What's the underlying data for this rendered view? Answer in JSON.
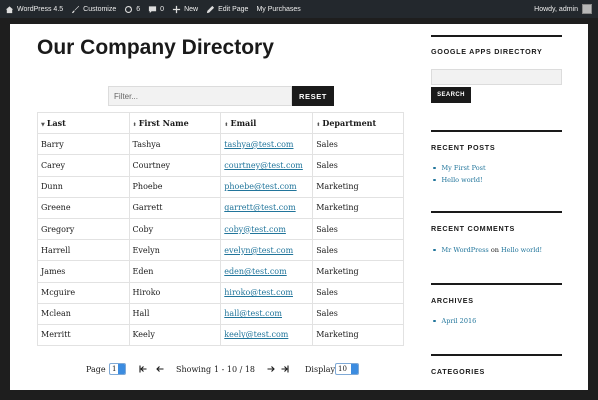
{
  "adminbar": {
    "site": "WordPress 4.5",
    "customize": "Customize",
    "updates": "6",
    "comments": "0",
    "new": "New",
    "edit_page": "Edit Page",
    "purchases": "My Purchases",
    "howdy": "Howdy, admin"
  },
  "main": {
    "title": "Our Company Directory",
    "filter_placeholder": "Filter...",
    "reset_label": "RESET"
  },
  "table": {
    "headers": [
      "Last",
      "First Name",
      "Email",
      "Department"
    ],
    "rows": [
      [
        "Barry",
        "Tashya",
        "tashya@test.com",
        "Sales"
      ],
      [
        "Carey",
        "Courtney",
        "courtney@test.com",
        "Sales"
      ],
      [
        "Dunn",
        "Phoebe",
        "phoebe@test.com",
        "Marketing"
      ],
      [
        "Greene",
        "Garrett",
        "garrett@test.com",
        "Marketing"
      ],
      [
        "Gregory",
        "Coby",
        "coby@test.com",
        "Sales"
      ],
      [
        "Harrell",
        "Evelyn",
        "evelyn@test.com",
        "Sales"
      ],
      [
        "James",
        "Eden",
        "eden@test.com",
        "Marketing"
      ],
      [
        "Mcguire",
        "Hiroko",
        "hiroko@test.com",
        "Sales"
      ],
      [
        "Mclean",
        "Hall",
        "hall@test.com",
        "Sales"
      ],
      [
        "Merritt",
        "Keely",
        "keely@test.com",
        "Marketing"
      ]
    ]
  },
  "pager": {
    "page_label": "Page",
    "page_value": "1",
    "showing_label": "Showing",
    "range": "1 - 10 / 18",
    "display_label": "Display",
    "display_value": "10"
  },
  "sidebar": {
    "gad_title": "GOOGLE APPS DIRECTORY",
    "search_label": "SEARCH",
    "recent_posts_title": "RECENT POSTS",
    "recent_posts": [
      "My First Post",
      "Hello world!"
    ],
    "recent_comments_title": "RECENT COMMENTS",
    "comment_author": "Mr WordPress",
    "comment_on": "on",
    "comment_post": "Hello world!",
    "archives_title": "ARCHIVES",
    "archives": [
      "April 2016"
    ],
    "categories_title": "CATEGORIES"
  },
  "colors": {
    "link": "#21759b",
    "adminbar": "#23282d",
    "button": "#1a1a1a"
  }
}
